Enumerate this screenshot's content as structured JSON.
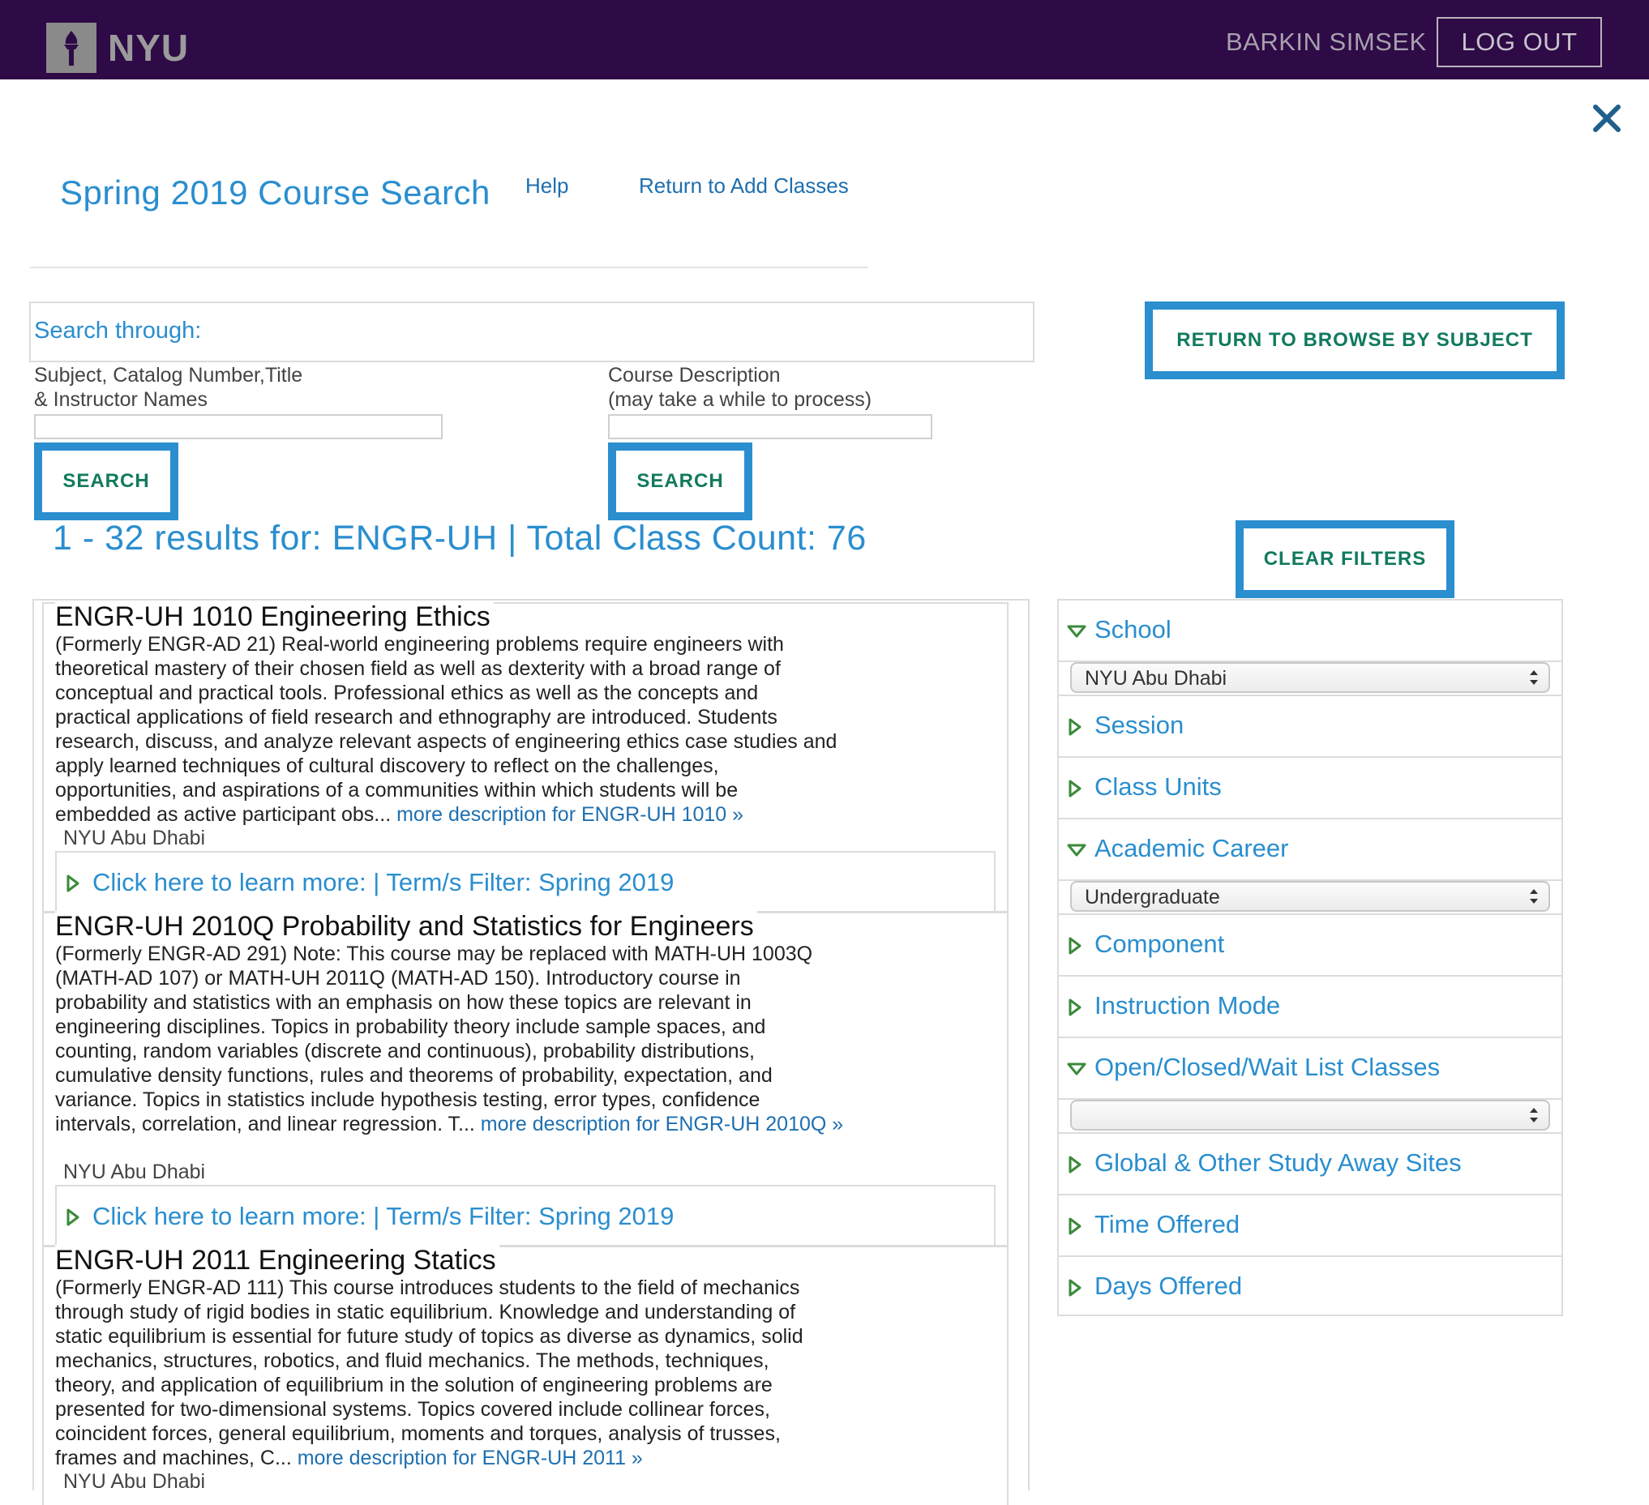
{
  "header": {
    "logo_text": "NYU",
    "user_name": "BARKIN SIMSEK",
    "logout_label": "LOG OUT"
  },
  "page": {
    "title": "Spring 2019 Course Search",
    "help_link": "Help",
    "return_add_link": "Return to Add Classes",
    "return_browse_label": "RETURN TO BROWSE BY SUBJECT",
    "clear_filters_label": "CLEAR FILTERS"
  },
  "search": {
    "heading": "Search through:",
    "left_label_line1": "Subject, Catalog Number,Title",
    "left_label_line2": "& Instructor Names",
    "left_value": "",
    "left_button": "SEARCH",
    "right_label_line1": "Course Description",
    "right_label_line2": "(may take a while to process)",
    "right_value": "",
    "right_button": "SEARCH"
  },
  "results_text": "1 - 32 results for: ENGR-UH | Total Class Count: 76",
  "courses": [
    {
      "title": "ENGR-UH 1010 Engineering Ethics",
      "description_lines": [
        "(Formerly ENGR-AD 21) Real-world engineering problems require engineers with",
        "theoretical mastery of their chosen field as well as dexterity with a broad range of",
        "conceptual and practical tools. Professional ethics as well as the concepts and",
        "practical applications of field research and ethnography are introduced. Students",
        "research, discuss, and analyze relevant aspects of engineering ethics case studies and",
        "apply learned techniques of cultural discovery to reflect on the challenges,",
        "opportunities, and aspirations of a communities within which students will be",
        "embedded as active participant obs... "
      ],
      "more_link": "more description for ENGR-UH 1010 »",
      "school": "NYU Abu Dhabi",
      "learn_more": "Click here to learn more: | Term/s Filter: Spring 2019"
    },
    {
      "title": "ENGR-UH 2010Q Probability and Statistics for Engineers",
      "description_lines": [
        "(Formerly ENGR-AD 291) Note: This course may be replaced with MATH-UH 1003Q",
        "(MATH-AD 107) or MATH-UH 2011Q (MATH-AD 150). Introductory course in",
        "probability and statistics with an emphasis on how these topics are relevant in",
        "engineering disciplines. Topics in probability theory include sample spaces, and",
        "counting, random variables (discrete and continuous), probability distributions,",
        "cumulative density functions, rules and theorems of probability, expectation, and",
        "variance. Topics in statistics include hypothesis testing, error types, confidence",
        "intervals, correlation, and linear regression. T... "
      ],
      "more_link": "more description for ENGR-UH 2010Q »",
      "school": "NYU Abu Dhabi",
      "learn_more": "Click here to learn more: | Term/s Filter: Spring 2019"
    },
    {
      "title": "ENGR-UH 2011 Engineering Statics",
      "description_lines": [
        "(Formerly ENGR-AD 111) This course introduces students to the field of mechanics",
        "through study of rigid bodies in static equilibrium. Knowledge and understanding of",
        "static equilibrium is essential for future study of topics as diverse as dynamics, solid",
        "mechanics, structures, robotics, and fluid mechanics. The methods, techniques,",
        "theory, and application of equilibrium in the solution of engineering problems are",
        "presented for two-dimensional systems. Topics covered include collinear forces,",
        "coincident forces, general equilibrium, moments and torques, analysis of trusses,",
        "frames and machines, C... "
      ],
      "more_link": "more description for ENGR-UH 2011 »",
      "school": "NYU Abu Dhabi"
    }
  ],
  "filters": [
    {
      "label": "School",
      "expanded": true,
      "value": "NYU Abu Dhabi"
    },
    {
      "label": "Session",
      "expanded": false
    },
    {
      "label": "Class Units",
      "expanded": false
    },
    {
      "label": "Academic Career",
      "expanded": true,
      "value": "Undergraduate"
    },
    {
      "label": "Component",
      "expanded": false
    },
    {
      "label": "Instruction Mode",
      "expanded": false
    },
    {
      "label": "Open/Closed/Wait List Classes",
      "expanded": true,
      "value": ""
    },
    {
      "label": "Global & Other Study Away Sites",
      "expanded": false
    },
    {
      "label": "Time Offered",
      "expanded": false
    },
    {
      "label": "Days Offered",
      "expanded": false
    }
  ],
  "colors": {
    "topbar": "#2e0a46",
    "accent_blue": "#2a8ecf",
    "link_blue": "#1e6fb0",
    "button_text_green": "#117a5f"
  },
  "icons": {
    "logo": "nyu-torch-icon",
    "close": "close-x-icon",
    "collapsed": "triangle-right-icon",
    "expanded": "triangle-down-icon",
    "select": "select-updown-arrows-icon"
  }
}
